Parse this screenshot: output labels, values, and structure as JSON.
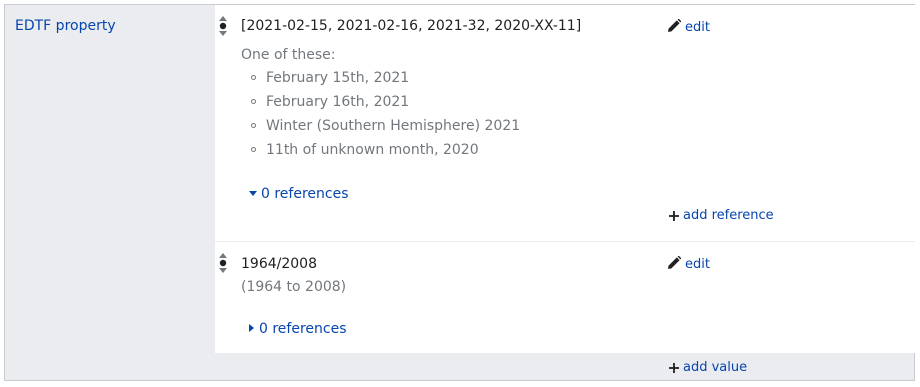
{
  "property": {
    "label": "EDTF property"
  },
  "statements": [
    {
      "value": "[2021-02-15, 2021-02-16, 2021-32, 2020-XX-11]",
      "description_heading": "One of these:",
      "description_items": [
        "February 15th, 2021",
        "February 16th, 2021",
        "Winter (Southern Hemisphere) 2021",
        "11th of unknown month, 2020"
      ],
      "edit_label": "edit",
      "references_label": "0 references",
      "references_expanded": true,
      "add_reference_label": "add reference"
    },
    {
      "value": "1964/2008",
      "description": "(1964 to 2008)",
      "edit_label": "edit",
      "references_label": "0 references",
      "references_expanded": false
    }
  ],
  "add_value_label": "add value",
  "colors": {
    "link": "#0645ad",
    "label_bg": "#eaecf0",
    "border": "#c8ccd1",
    "muted_text": "#72777d"
  },
  "icons": {
    "rank": "rank-selector-icon",
    "edit": "pencil-icon",
    "add": "plus-icon",
    "expanded": "caret-down-icon",
    "collapsed": "caret-right-icon"
  }
}
